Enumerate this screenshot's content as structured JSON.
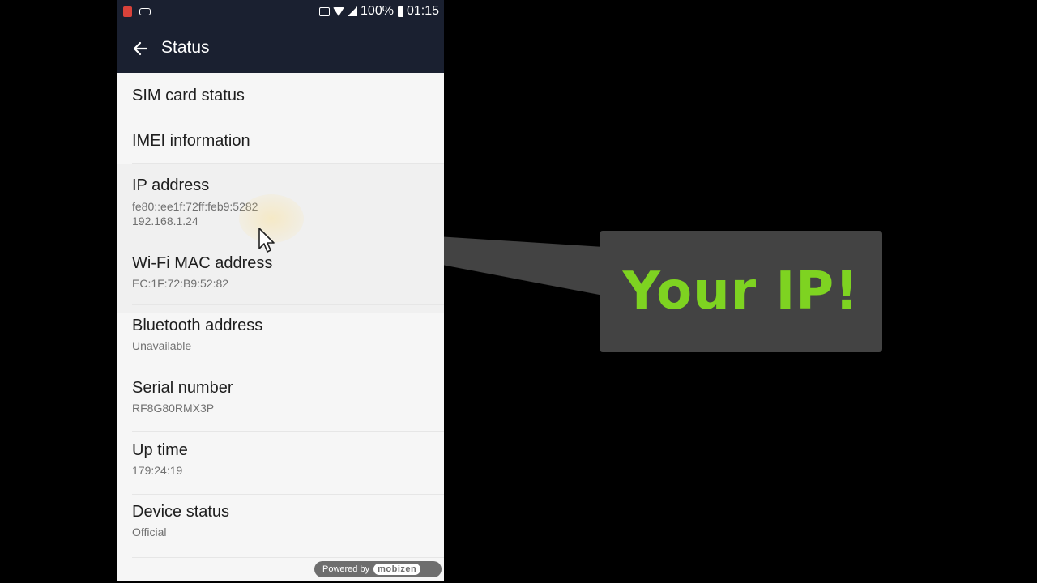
{
  "status_bar": {
    "battery": "100%",
    "time": "01:15"
  },
  "header": {
    "title": "Status"
  },
  "items": [
    {
      "title": "SIM card status"
    },
    {
      "title": "IMEI information"
    },
    {
      "title": "IP address",
      "values": [
        "fe80::ee1f:72ff:feb9:5282",
        "192.168.1.24"
      ]
    },
    {
      "title": "Wi-Fi MAC address",
      "values": [
        "EC:1F:72:B9:52:82"
      ]
    },
    {
      "title": "Bluetooth address",
      "values": [
        "Unavailable"
      ]
    },
    {
      "title": "Serial number",
      "values": [
        "RF8G80RMX3P"
      ]
    },
    {
      "title": "Up time",
      "values": [
        "179:24:19"
      ]
    },
    {
      "title": "Device status",
      "values": [
        "Official"
      ]
    }
  ],
  "watermark": {
    "label": "Powered by",
    "brand": "mobizen"
  },
  "callout": {
    "text": "Your IP!",
    "color": "#7ed321"
  },
  "colors": {
    "app_bar": "#1a2030",
    "list_background": "#f6f6f6",
    "callout_background": "#434343"
  },
  "icons": {
    "back": "arrow-left-icon",
    "cursor": "mouse-pointer-icon"
  }
}
